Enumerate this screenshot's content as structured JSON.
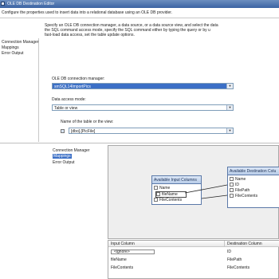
{
  "dialog1": {
    "title": "OLE DB Destination Editor",
    "description": "Configure the properties used to insert data into a relational database using an OLE DB provider.",
    "nav": [
      "Connection Manager",
      "Mappings",
      "Error Output"
    ],
    "instructions": [
      "Specify an OLE DB connection manager, a data source, or a data source view, and select the data",
      "the SQL command access mode, specify the SQL command either by typing the query or by u",
      "fast-load data access, set the table update options."
    ],
    "connection_label": "OLE DB connection manager:",
    "connection_value": "smSQL14ImportPics",
    "access_label": "Data access mode:",
    "access_value": "Table or view",
    "table_label": "Name of the table or the view:",
    "table_value": "[dbo].[PicFile]"
  },
  "dialog2": {
    "nav": [
      "Connection Manager",
      "Mappings",
      "Error Output"
    ],
    "input_box": {
      "title": "Available Input Columns",
      "header": "Name",
      "rows": [
        "fileName",
        "FileContents"
      ]
    },
    "dest_box": {
      "title": "Available Destination Colu",
      "header": "Name",
      "rows": [
        "ID",
        "FilePath",
        "FileContents"
      ]
    },
    "mapping": {
      "col1": "Input Column",
      "col2": "Destination Column",
      "rows": [
        [
          "<ignore>",
          "ID"
        ],
        [
          "fileName",
          "FilePath"
        ],
        [
          "FileContents",
          "FileContents"
        ]
      ]
    }
  }
}
